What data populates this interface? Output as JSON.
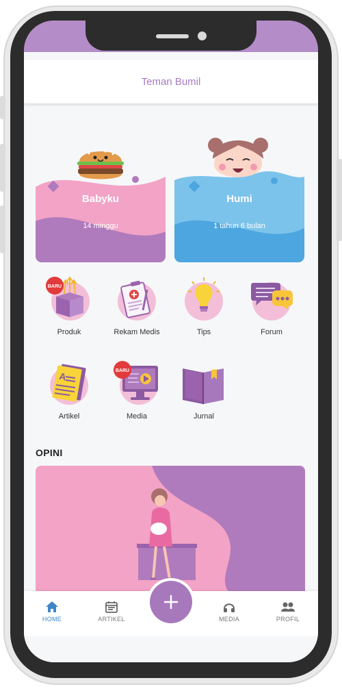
{
  "header": {
    "title": "Teman Bumil"
  },
  "cards": [
    {
      "name": "Babyku",
      "age": "14 minggu",
      "icon": "burger-icon",
      "color": "#f2a3c6"
    },
    {
      "name": "Humi",
      "age": "1 tahun 6 bulan",
      "icon": "girl-face-icon",
      "color": "#7cc3ec"
    }
  ],
  "menu": [
    {
      "label": "Produk",
      "icon": "gift-box-icon",
      "badge": "BARU"
    },
    {
      "label": "Rekam Medis",
      "icon": "medical-record-icon"
    },
    {
      "label": "Tips",
      "icon": "lightbulb-icon"
    },
    {
      "label": "Forum",
      "icon": "chat-bubbles-icon"
    },
    {
      "label": "Artikel",
      "icon": "newspaper-icon"
    },
    {
      "label": "Media",
      "icon": "monitor-play-icon",
      "badge": "BARU"
    },
    {
      "label": "Jurnal",
      "icon": "book-icon"
    }
  ],
  "opini": {
    "title": "OPINI",
    "illustration": "pregnant-woman-illustration"
  },
  "nav": {
    "items": [
      {
        "label": "HOME",
        "icon": "home-icon",
        "active": true
      },
      {
        "label": "ARTIKEL",
        "icon": "calendar-icon"
      },
      {
        "label": "MEDIA",
        "icon": "headphones-icon"
      },
      {
        "label": "PROFIL",
        "icon": "people-icon"
      }
    ],
    "fab_icon": "plus-icon"
  },
  "colors": {
    "accent": "#a77bc2",
    "pink": "#f2a3c6",
    "blue": "#7cc3ec",
    "nav_active": "#3e86c8"
  }
}
